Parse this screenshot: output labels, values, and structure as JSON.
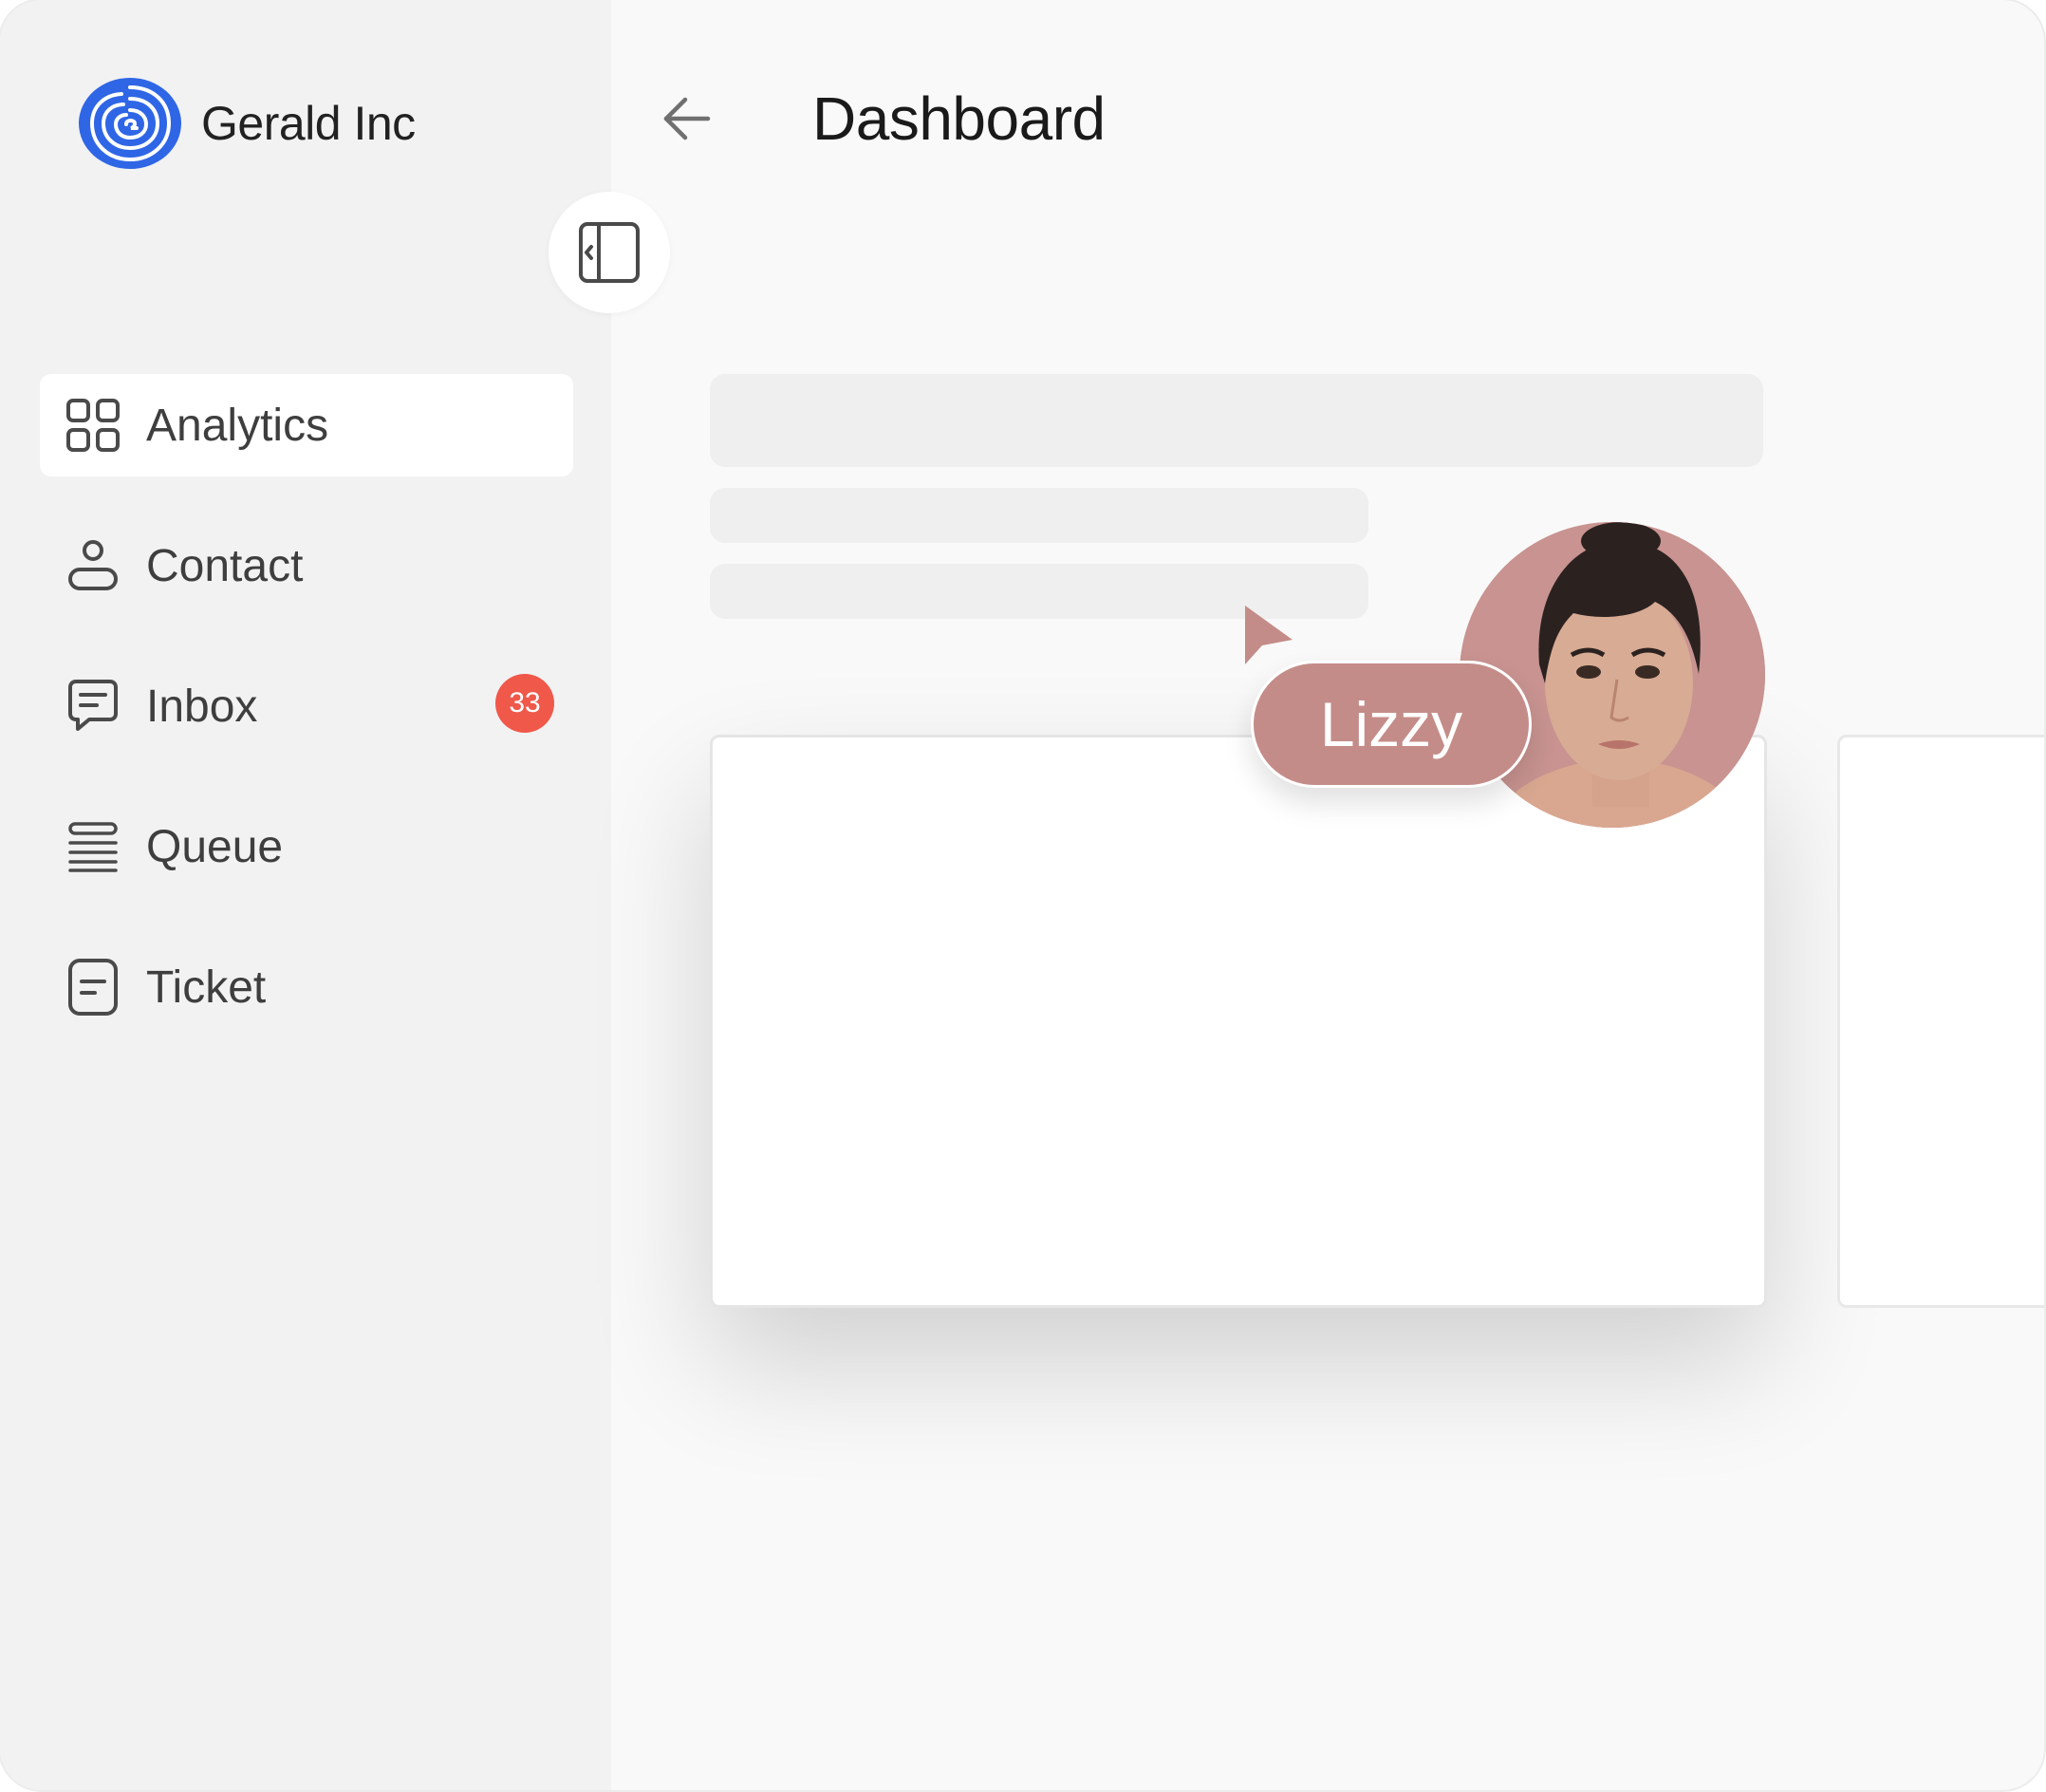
{
  "brand": {
    "name": "Gerald Inc",
    "logo_icon": "spiral-logo-icon",
    "accent": "#2f66e6"
  },
  "header": {
    "title": "Dashboard",
    "back_icon": "arrow-left-icon"
  },
  "sidebar": {
    "collapse_icon": "sidebar-collapse-icon",
    "items": [
      {
        "label": "Analytics",
        "icon": "grid-icon",
        "active": true
      },
      {
        "label": "Contact",
        "icon": "user-icon"
      },
      {
        "label": "Inbox",
        "icon": "message-icon",
        "badge": "33"
      },
      {
        "label": "Queue",
        "icon": "list-icon"
      },
      {
        "label": "Ticket",
        "icon": "document-icon"
      }
    ]
  },
  "collaborator": {
    "name": "Lizzy",
    "color": "#c48c88",
    "cursor_icon": "pointer-cursor-icon"
  },
  "colors": {
    "badge": "#f0584a",
    "sidebar_bg": "#f2f2f2",
    "main_bg": "#f9f9f9"
  }
}
